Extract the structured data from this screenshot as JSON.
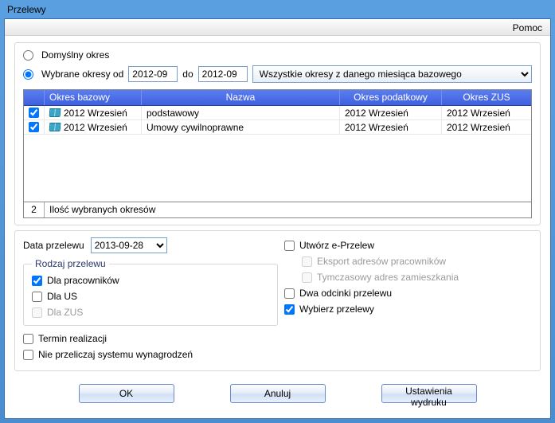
{
  "window": {
    "title": "Przelewy"
  },
  "help": {
    "label": "Pomoc"
  },
  "period": {
    "default_label": "Domyślny  okres",
    "selected_label": "Wybrane okresy od",
    "from": "2012-09",
    "to_label": "do",
    "to": "2012-09",
    "combo_selected": "Wszystkie okresy z danego miesiąca bazowego"
  },
  "table": {
    "headers": {
      "base": "Okres bazowy",
      "name": "Nazwa",
      "tax": "Okres podatkowy",
      "zus": "Okres ZUS"
    },
    "rows": [
      {
        "checked": true,
        "base": "2012 Wrzesień",
        "name": "podstawowy",
        "tax": "2012 Wrzesień",
        "zus": "2012 Wrzesień"
      },
      {
        "checked": true,
        "base": "2012 Wrzesień",
        "name": "Umowy cywilnoprawne",
        "tax": "2012 Wrzesień",
        "zus": "2012 Wrzesień"
      }
    ],
    "footer": {
      "count": "2",
      "label": "Ilość wybranych okresów"
    }
  },
  "form": {
    "date_label": "Data przelewu",
    "date_value": "2013-09-28",
    "rodzaj_legend": "Rodzaj przelewu",
    "dla_pracownikow": "Dla pracowników",
    "dla_us": "Dla US",
    "dla_zus": "Dla ZUS",
    "utworz": "Utwórz e-Przelew",
    "eksport": "Eksport adresów pracowników",
    "tymczasowy": "Tymczasowy adres zamieszkania",
    "dwa_odcinki": "Dwa odcinki przelewu",
    "wybierz": "Wybierz przelewy",
    "termin": "Termin realizacji",
    "nie_przeliczaj": "Nie przeliczaj systemu wynagrodzeń"
  },
  "buttons": {
    "ok": "OK",
    "cancel": "Anuluj",
    "print": "Ustawienia wydruku"
  }
}
